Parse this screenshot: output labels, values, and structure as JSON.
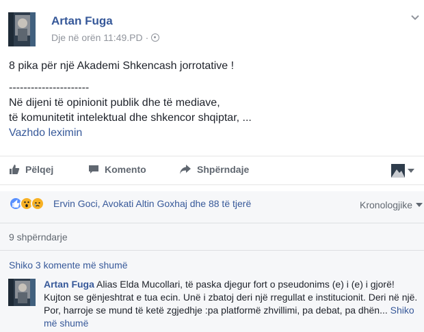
{
  "post": {
    "author": "Artan Fuga",
    "time": "Dje në orën 11:49.PD",
    "separator": "·",
    "privacy_icon": "globe-icon",
    "lines": [
      "8 pika për një Akademi Shkencash jorrotative !",
      "----------------------",
      "Në dijeni të opinionit publik dhe të mediave,",
      "të komunitetit intelektual dhe shkencor shqiptar, ..."
    ],
    "see_more": "Vazhdo leximin"
  },
  "actions": {
    "like": "Pëlqej",
    "comment": "Komento",
    "share": "Shpërndaje"
  },
  "reactions": {
    "icons": [
      "like-reaction",
      "wow-reaction",
      "sad-reaction"
    ],
    "names": "Ervin Goci, Avokati Altin Goxhaj dhe 88 të tjerë",
    "order": "Kronologjike"
  },
  "shares": "9 shpërndarje",
  "more_comments": "Shiko 3 komente më shumë",
  "comment": {
    "author": "Artan Fuga",
    "text": "Alias Elda Mucollari, të paska djegur fort o pseudonims (e) i (e) i gjorë! Kujton se gënjeshtrat e tua ecin. Unë i zbatoj deri një rregullat e institucionit. Deri në një. Por, harroje se mund të ketë zgjedhje :pa platformë zhvillimi, pa debat, pa dhën...",
    "see_more": "Shiko më shumë"
  },
  "colors": {
    "link": "#365899",
    "muted": "#90949c",
    "like_blue": "#5890ff",
    "reaction_yellow": "#f7b125",
    "band": "#f6f7f9"
  }
}
